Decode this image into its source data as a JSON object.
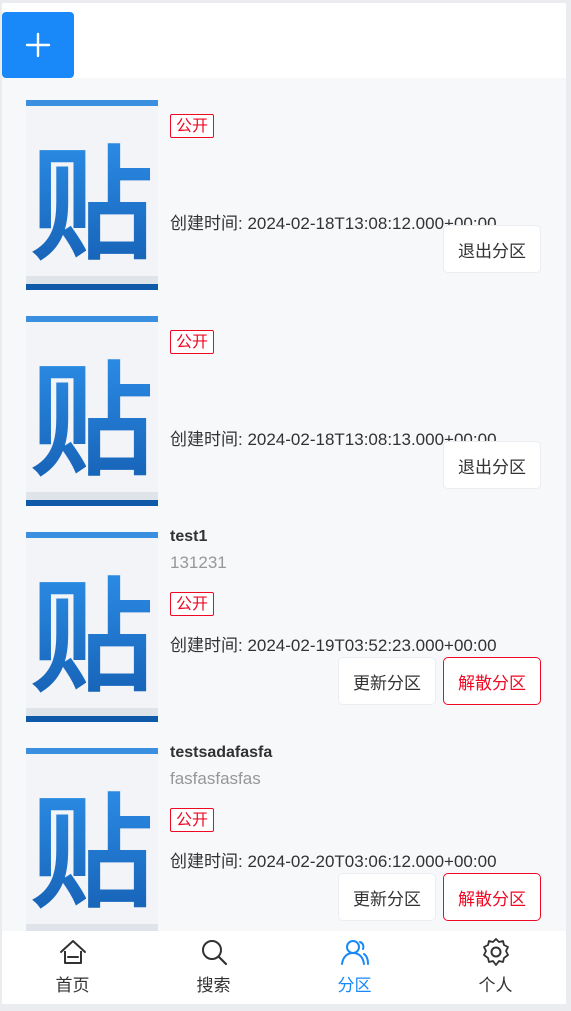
{
  "topbar": {
    "add_icon": "plus-icon"
  },
  "cards": [
    {
      "title": "",
      "desc": "",
      "tag": "公开",
      "created": "创建时间: 2024-02-18T13:08:12.000+00:00",
      "buttons": [
        "退出分区"
      ]
    },
    {
      "title": "",
      "desc": "",
      "tag": "公开",
      "created": "创建时间: 2024-02-18T13:08:13.000+00:00",
      "buttons": [
        "退出分区"
      ]
    },
    {
      "title": "test1",
      "desc": "131231",
      "tag": "公开",
      "created": "创建时间: 2024-02-19T03:52:23.000+00:00",
      "buttons": [
        "更新分区",
        "解散分区"
      ]
    },
    {
      "title": "testsadafasfa",
      "desc": "fasfasfasfas",
      "tag": "公开",
      "created": "创建时间: 2024-02-20T03:06:12.000+00:00",
      "buttons": [
        "更新分区",
        "解散分区"
      ]
    }
  ],
  "thumb": {
    "glyph": "贴",
    "icon": "tieba-logo-icon"
  },
  "tabbar": {
    "items": [
      {
        "label": "首页",
        "icon": "home-icon"
      },
      {
        "label": "搜索",
        "icon": "search-icon"
      },
      {
        "label": "分区",
        "icon": "users-icon"
      },
      {
        "label": "个人",
        "icon": "gear-icon"
      }
    ],
    "active": 2
  },
  "colors": {
    "primary": "#1989fa",
    "danger": "#ee0a24",
    "muted": "#969799"
  }
}
